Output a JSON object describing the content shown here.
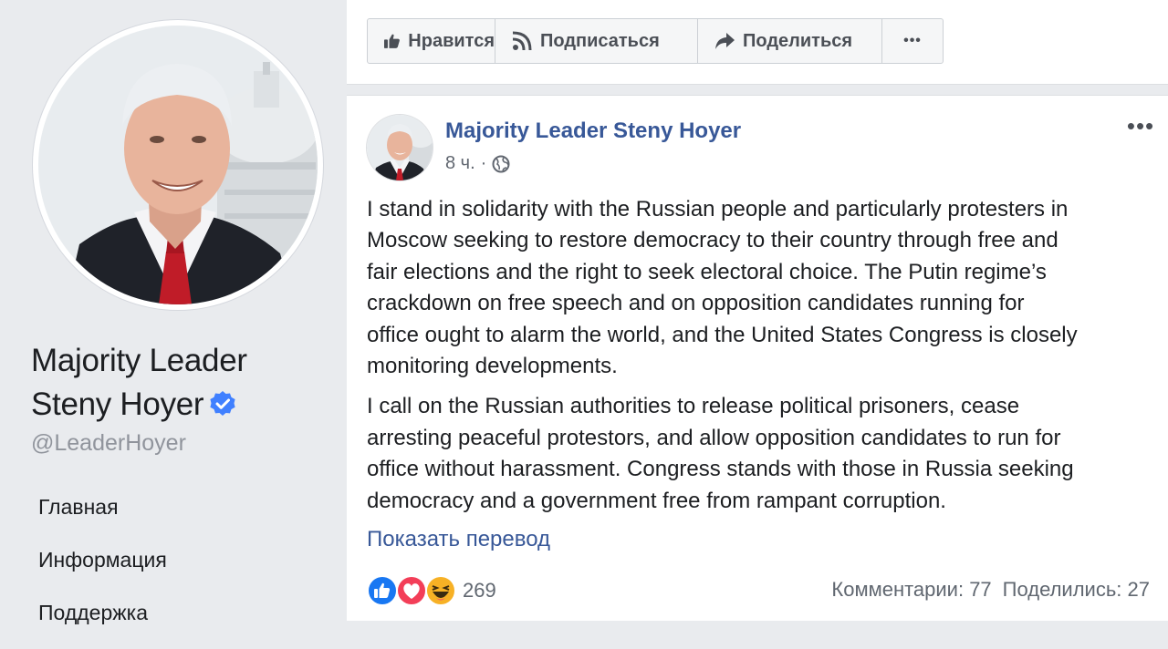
{
  "sidebar": {
    "page_name_line1": "Majority Leader",
    "page_name_line2": "Steny Hoyer",
    "username": "@LeaderHoyer",
    "nav": [
      {
        "label": "Главная"
      },
      {
        "label": "Информация"
      },
      {
        "label": "Поддержка"
      }
    ]
  },
  "actions": {
    "like": "Нравится",
    "subscribe": "Подписаться",
    "share": "Поделиться",
    "more": "•••"
  },
  "post": {
    "author": "Majority Leader Steny Hoyer",
    "time": "8 ч.",
    "separator": "·",
    "options": "•••",
    "paragraph1_lines": [
      "I stand in solidarity with the Russian people and particularly protesters in",
      "Moscow seeking to restore democracy to their country through free and",
      "fair elections and the right to seek electoral choice. The Putin regime’s",
      "crackdown on free speech and on opposition candidates running for",
      "office ought to alarm the world, and the United States Congress is closely",
      "monitoring developments."
    ],
    "paragraph2_lines": [
      "I call on the Russian authorities to release political prisoners, cease",
      "arresting peaceful protestors, and allow opposition candidates to run for",
      "office without harassment. Congress stands with those in Russia seeking",
      "democracy and a government free from rampant corruption."
    ],
    "translate_link": "Показать перевод",
    "reaction_count": "269",
    "comments": "Комментарии: 77",
    "shares": "Поделились: 27"
  },
  "icons": {
    "like": "thumbs-up-icon",
    "subscribe": "rss-icon",
    "share": "share-arrow-icon",
    "globe": "globe-icon",
    "verified": "verified-badge-icon"
  },
  "colors": {
    "link": "#385898",
    "verified": "#4080ff",
    "like_reaction": "#1877f2",
    "love_reaction": "#f33e58",
    "haha_reaction": "#f7b125"
  }
}
